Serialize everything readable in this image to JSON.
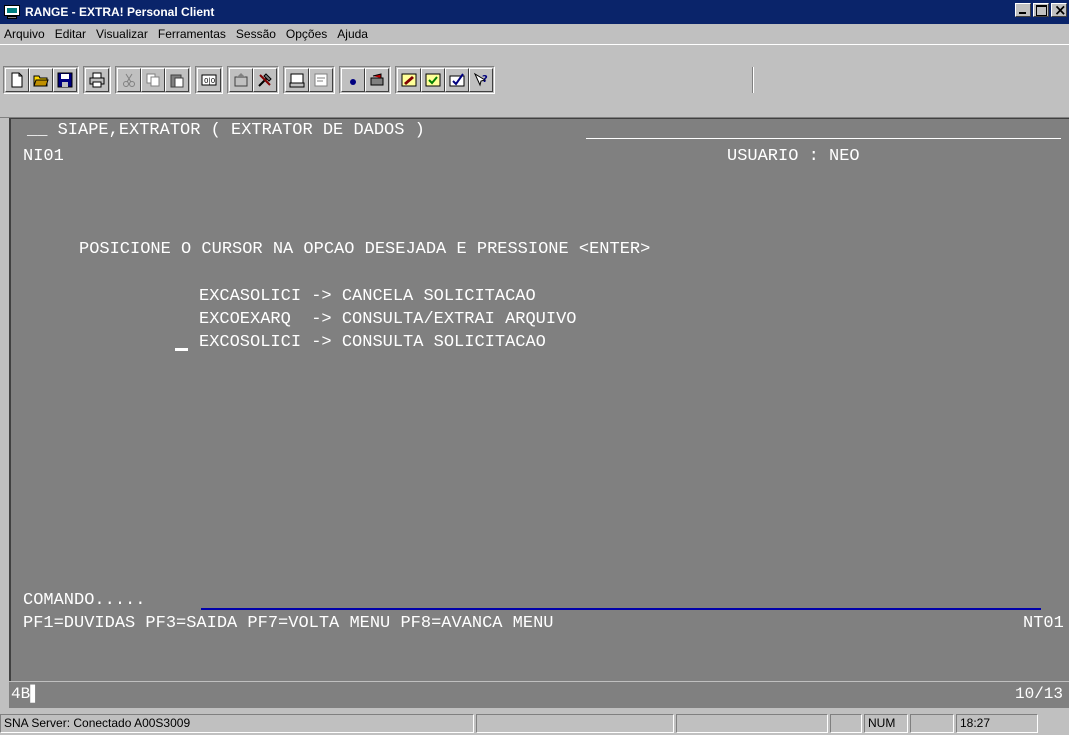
{
  "window": {
    "title": "RANGE - EXTRA! Personal Client",
    "controls": {
      "minimize": "minimize-icon",
      "maximize": "maximize-icon",
      "close": "close-icon"
    }
  },
  "menu": {
    "items": [
      {
        "label": "Arquivo"
      },
      {
        "label": "Editar"
      },
      {
        "label": "Visualizar"
      },
      {
        "label": "Ferramentas"
      },
      {
        "label": "Sessão"
      },
      {
        "label": "Opções"
      },
      {
        "label": "Ajuda"
      }
    ]
  },
  "toolbar": {
    "icons": [
      "new-icon",
      "open-icon",
      "save-icon",
      "print-icon",
      "cut-icon",
      "copy-icon",
      "paste-icon",
      "macro-icon",
      "transfer-icon",
      "tools-icon",
      "print-screen-icon",
      "capture-icon",
      "record-icon",
      "playback-icon",
      "edit-session-icon",
      "settings-icon",
      "check-icon",
      "help-icon"
    ]
  },
  "terminal": {
    "header": "__ SIAPE,EXTRATOR ( EXTRATOR DE DADOS )",
    "screen_id": "NI01",
    "user_label": "USUARIO : NEO",
    "instruction": "POSICIONE O CURSOR NA OPCAO DESEJADA E PRESSIONE <ENTER>",
    "options": [
      {
        "code": "EXCASOLICI",
        "arrow": "->",
        "desc": "CANCELA SOLICITACAO"
      },
      {
        "code": "EXCOEXARQ ",
        "arrow": "->",
        "desc": "CONSULTA/EXTRAI ARQUIVO"
      },
      {
        "code": "EXCOSOLICI",
        "arrow": "->",
        "desc": "CONSULTA SOLICITACAO"
      }
    ],
    "command_label": "COMANDO.....",
    "command_value": "",
    "function_keys": "PF1=DUVIDAS PF3=SAIDA PF7=VOLTA MENU PF8=AVANCA MENU",
    "right_code": "NT01"
  },
  "oia": {
    "left": "4B▌",
    "position": "10/13"
  },
  "status": {
    "connection": "SNA Server: Conectado A00S3009",
    "cell2": "",
    "cell3": "",
    "cell4": "",
    "num": "NUM",
    "cell6": "",
    "time": "18:27"
  }
}
